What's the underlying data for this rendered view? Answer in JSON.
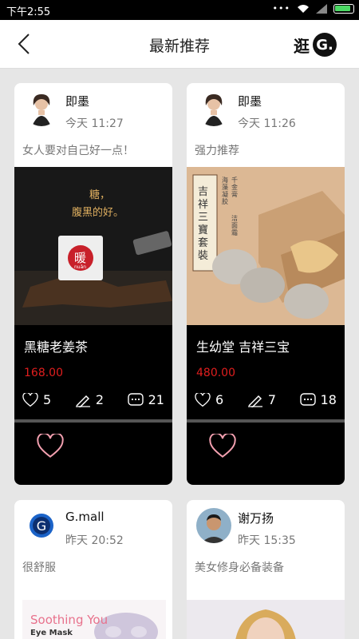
{
  "status_bar": {
    "time": "下午2:55"
  },
  "header": {
    "title": "最新推荐",
    "shop_label": "逛",
    "shop_logo": "G."
  },
  "cards": [
    {
      "author": "即墨",
      "time": "今天 11:27",
      "desc": "女人要对自己好一点！",
      "image_text": [
        "糖，",
        "腹黑的好。"
      ],
      "stamp_text": "暖",
      "stamp_sub": "nuǎn",
      "product": "黑糖老姜茶",
      "price": "168.00",
      "likes": "5",
      "edits": "2",
      "comments": "21"
    },
    {
      "author": "即墨",
      "time": "今天 11:26",
      "desc": "强力推荐",
      "image_text": [
        "吉祥三寶套裝"
      ],
      "image_side": [
        "千金膏",
        "海藻凝胶",
        "洁面霜"
      ],
      "product": "生幼堂 吉祥三宝",
      "price": "480.00",
      "likes": "6",
      "edits": "7",
      "comments": "18"
    },
    {
      "author": "G.mall",
      "time": "昨天 20:52",
      "desc": "很舒服",
      "image_text": [
        "Soothing You",
        "Eye Mask"
      ]
    },
    {
      "author": "谢万扬",
      "time": "昨天 15:35",
      "desc": "美女修身必备装备"
    }
  ],
  "colors": {
    "price": "#e01e1e",
    "heart": "#f3a0b0",
    "card_dark": "#000000"
  }
}
